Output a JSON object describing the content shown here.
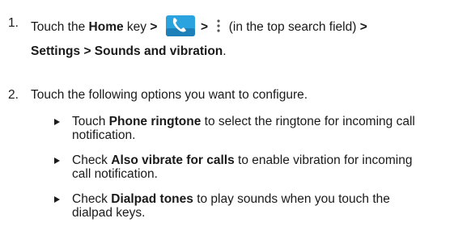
{
  "steps": [
    {
      "number": "1.",
      "line1": {
        "t1": "Touch the ",
        "b1": "Home",
        "t2": " key ",
        "gt1": ">",
        "gt2": ">",
        "t3": " (in the top search field) ",
        "gt3": ">"
      },
      "line2": {
        "b1": "Settings > Sounds and vibration",
        "t1": "."
      }
    },
    {
      "number": "2.",
      "text": "Touch the following options you want to configure."
    }
  ],
  "bullets": [
    {
      "t1": "Touch ",
      "b1": "Phone ringtone",
      "t2": " to select the ringtone for incoming call",
      "t3": "notification."
    },
    {
      "t1": "Check ",
      "b1": "Also vibrate for calls",
      "t2": " to enable vibration for incoming",
      "t3": "call notification."
    },
    {
      "t1": "Check ",
      "b1": "Dialpad tones",
      "t2": " to play sounds when you touch the",
      "t3": "dialpad keys."
    }
  ],
  "icons": {
    "phone": "phone-app-icon",
    "menu": "more-options-icon",
    "bullet": "triangle-bullet-icon"
  },
  "colors": {
    "phone_tile": "#2aa3de",
    "phone_tile_dark": "#1e80b8",
    "text": "#1a1a1a"
  }
}
